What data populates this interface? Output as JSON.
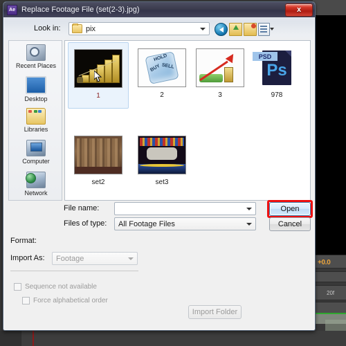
{
  "window": {
    "title": "Replace Footage File (set(2-3).jpg)",
    "app_icon": "after-effects-icon",
    "app_icon_label": "Ae",
    "close_label": "x"
  },
  "toolbar": {
    "lookin_label": "Look in:",
    "lookin_value": "pix",
    "lookin_icon": "folder-icon",
    "buttons": [
      {
        "name": "back-icon",
        "tooltip": "Back"
      },
      {
        "name": "up-folder-icon",
        "tooltip": "Up One Level"
      },
      {
        "name": "new-folder-icon",
        "tooltip": "Create New Folder"
      },
      {
        "name": "views-icon",
        "tooltip": "Views"
      }
    ]
  },
  "places": [
    {
      "label": "Recent Places",
      "icon": "recent-places-icon"
    },
    {
      "label": "Desktop",
      "icon": "desktop-icon"
    },
    {
      "label": "Libraries",
      "icon": "libraries-icon"
    },
    {
      "label": "Computer",
      "icon": "computer-icon"
    },
    {
      "label": "Network",
      "icon": "network-icon"
    }
  ],
  "files": [
    {
      "label": "1",
      "thumb": "gold-bars-chart-image",
      "selected": true
    },
    {
      "label": "2",
      "thumb": "buy-sell-hold-dice-image",
      "selected": false
    },
    {
      "label": "3",
      "thumb": "red-arrow-growth-image",
      "selected": false
    },
    {
      "label": "978",
      "thumb": "photoshop-psd-file-icon",
      "selected": false,
      "psd_tag": "PSD",
      "psd_mark": "Ps"
    },
    {
      "label": "set2",
      "thumb": "library-bookshelf-image",
      "selected": false
    },
    {
      "label": "set3",
      "thumb": "stage-set-image",
      "selected": false
    }
  ],
  "form": {
    "filename_label": "File name:",
    "filename_value": "",
    "filename_placeholder": "",
    "filetype_label": "Files of type:",
    "filetype_value": "All Footage Files",
    "open_label": "Open",
    "cancel_label": "Cancel"
  },
  "options": {
    "format_label": "Format:",
    "format_value": "",
    "import_as_label": "Import As:",
    "import_as_value": "Footage",
    "sequence_label": "Sequence not available",
    "sequence_checked": false,
    "force_alpha_label": "Force alphabetical order",
    "force_alpha_checked": false,
    "import_folder_label": "Import Folder"
  },
  "background": {
    "time_value": "+0.0",
    "frame_value": "20f"
  },
  "colors": {
    "accent_red": "#ee1111",
    "focus_blue": "#3c7fb1",
    "title_gradient_start": "#4d4e62",
    "ae_purple": "#4b2d86",
    "ae_orange": "#e8a33d"
  }
}
